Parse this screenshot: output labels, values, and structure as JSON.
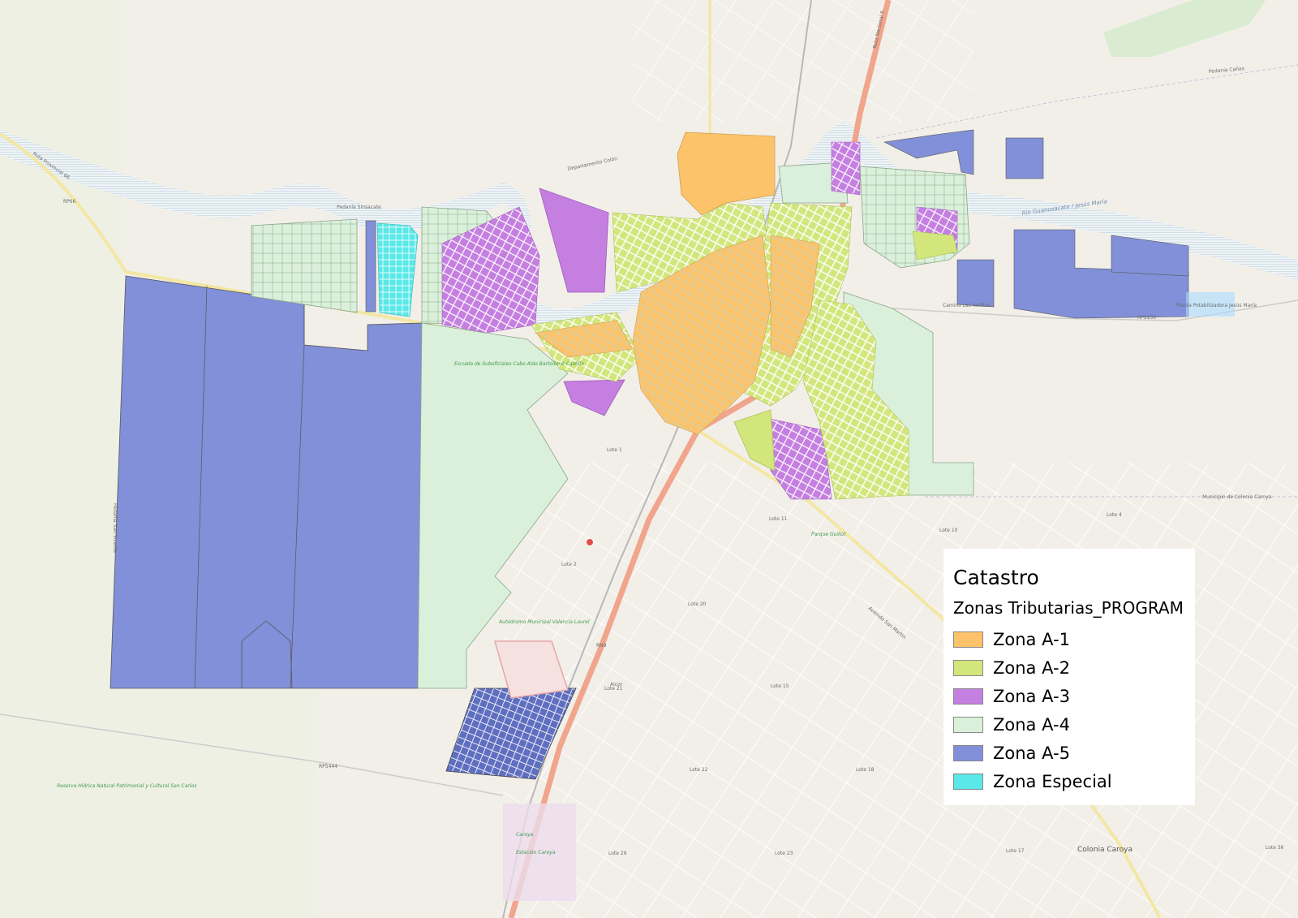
{
  "legend": {
    "title": "Catastro",
    "layer_name": "Zonas Tributarias_PROGRAM",
    "items": [
      {
        "label": "Zona A-1",
        "color": "#fcc36a"
      },
      {
        "label": "Zona A-2",
        "color": "#d2e67c"
      },
      {
        "label": "Zona A-3",
        "color": "#c57fe0"
      },
      {
        "label": "Zona A-4",
        "color": "#dbf0da"
      },
      {
        "label": "Zona A-5",
        "color": "#8190d8"
      },
      {
        "label": "Zona Especial",
        "color": "#5ae8e8"
      }
    ]
  },
  "map_labels": {
    "rp66": "RP66",
    "ruta_66": "Ruta Provincial 66",
    "pedania_sinsacate": "Pedanía Sinsacate",
    "departamento_colon": "Departamento Colón",
    "rio_guanusacate": "Río Guanusacate / Jesús María",
    "ruta_nacional_9": "Ruta Nacional 9",
    "escuela": "Escuela de Suboficiales Cabo Aldo Bartolomé Castillo",
    "autodromo": "Autódromo Municipal Valencia Laurel",
    "lote_1": "Lote 1",
    "lote_2": "Lote 2",
    "lote_4": "Lote 4",
    "lote_10": "Lote 10",
    "lote_11": "Lote 11",
    "lote_15": "Lote 15",
    "lote_17": "Lote 17",
    "lote_18": "Lote 18",
    "lote_20": "Lote 20",
    "lote_21": "Lote 21",
    "lote_22": "Lote 22",
    "lote_23": "Lote 23",
    "lote_29": "Lote 29",
    "lote_36": "Lote 36",
    "colonia_caroya": "Colonia Caroya",
    "municipio_colonia_caroya": "Municipio de Colonia Caroya",
    "caroya": "Caroya",
    "estacion_caroya": "Estación Caroya",
    "reserva": "Reserva Hídrica Natural Patrimonial y Cultural San Carlos",
    "rp5444": "RP5444",
    "camino_las_astillas": "Camino Las Astillas",
    "rps136": "RPS136",
    "planta": "Planta Potabilizadora Jesús María",
    "parque_gutierrez": "Parque Guillot",
    "pedania_san_vicente": "Pedanía San Vicente",
    "pedania_cañas": "Pedanía Cañas",
    "avenida_san_martin": "Avenida San Martín",
    "aicor": "Aicor",
    "rn9": "RN9"
  }
}
